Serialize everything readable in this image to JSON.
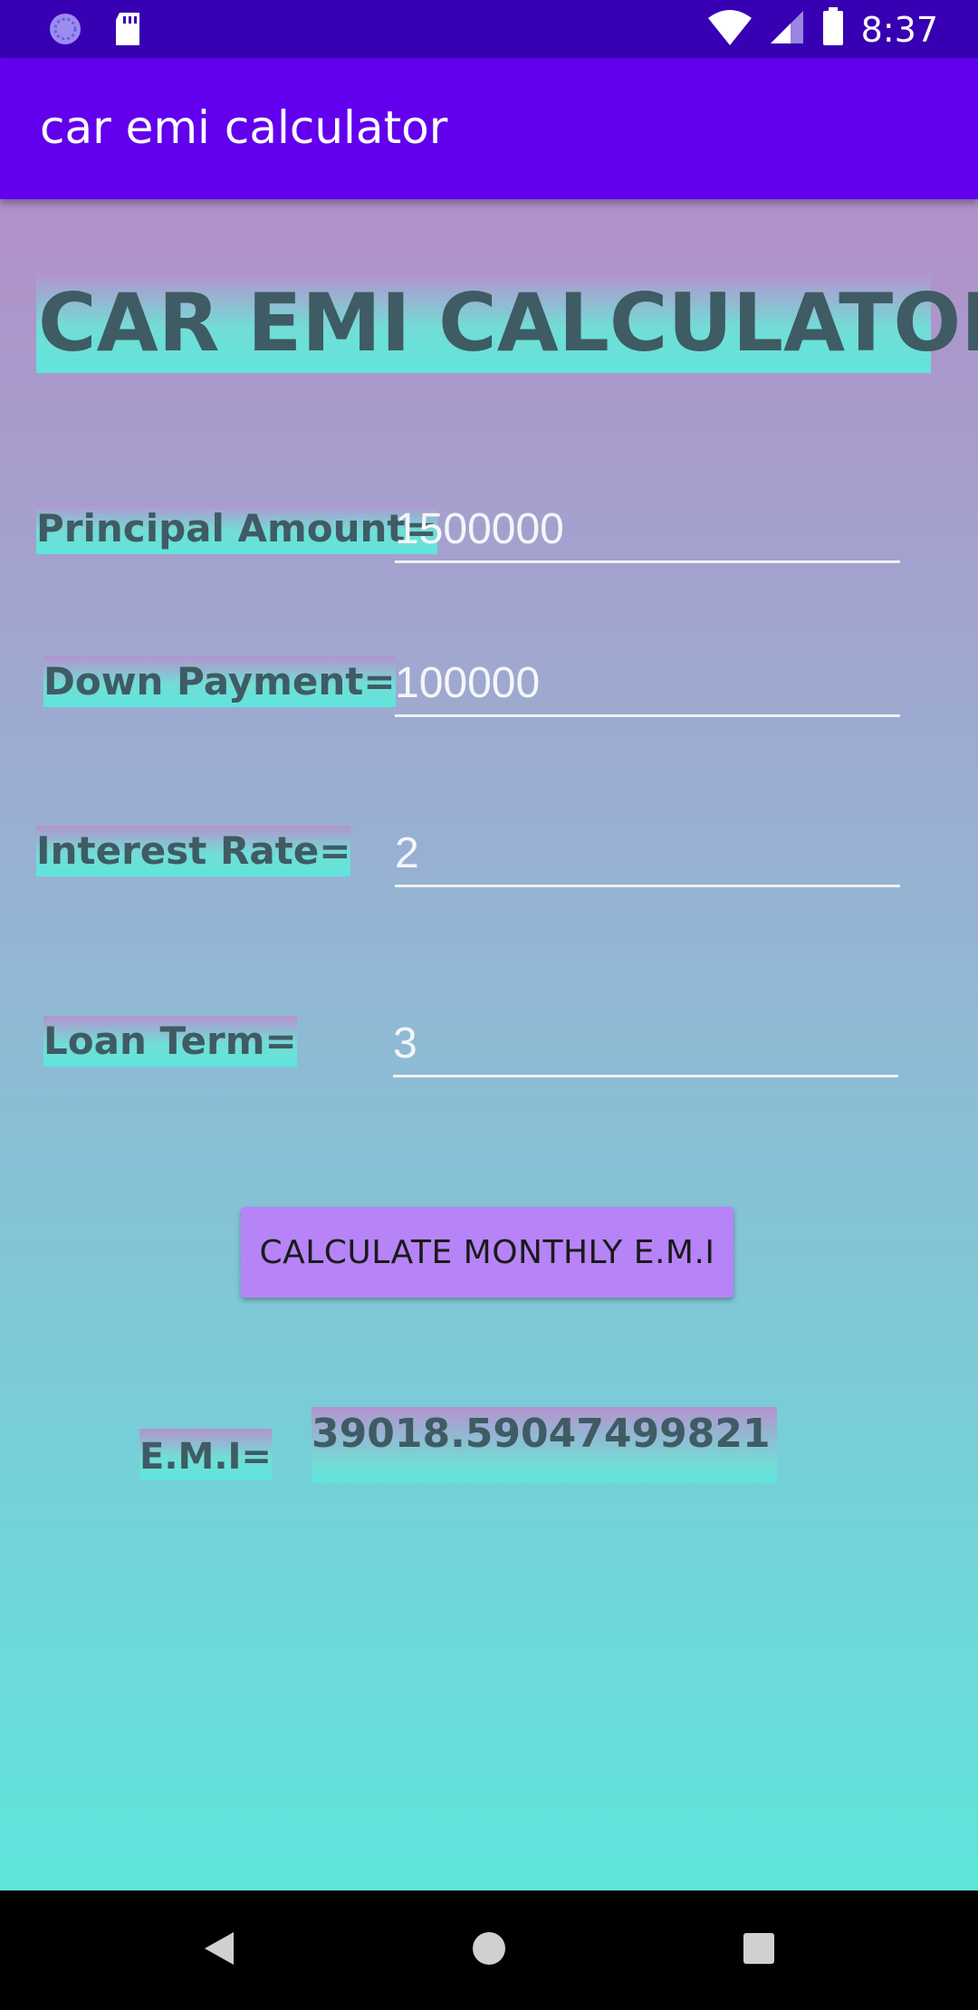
{
  "status_bar": {
    "time": "8:37",
    "icons": [
      "sync-icon",
      "sd-card-icon",
      "wifi-icon",
      "signal-icon",
      "battery-icon"
    ]
  },
  "app_bar": {
    "title": "car emi calculator"
  },
  "main": {
    "heading": "CAR EMI CALCULATOR",
    "fields": {
      "principal": {
        "label": "Principal Amount=",
        "value": "1500000"
      },
      "down_payment": {
        "label": "Down Payment=",
        "value": "100000"
      },
      "interest": {
        "label": "Interest Rate=",
        "value": "2"
      },
      "loan_term": {
        "label": "Loan Term=",
        "value": "3"
      }
    },
    "button_label": "CALCULATE MONTHLY E.M.I",
    "result_label": "E.M.I=",
    "result_value": "39018.59047499821"
  },
  "nav_bar": {
    "icons": [
      "back-icon",
      "home-icon",
      "recents-icon"
    ]
  },
  "colors": {
    "status_bar": "#3700b3",
    "app_bar": "#6200ee",
    "button": "#b784f7",
    "label_text": "#3f5b63"
  }
}
